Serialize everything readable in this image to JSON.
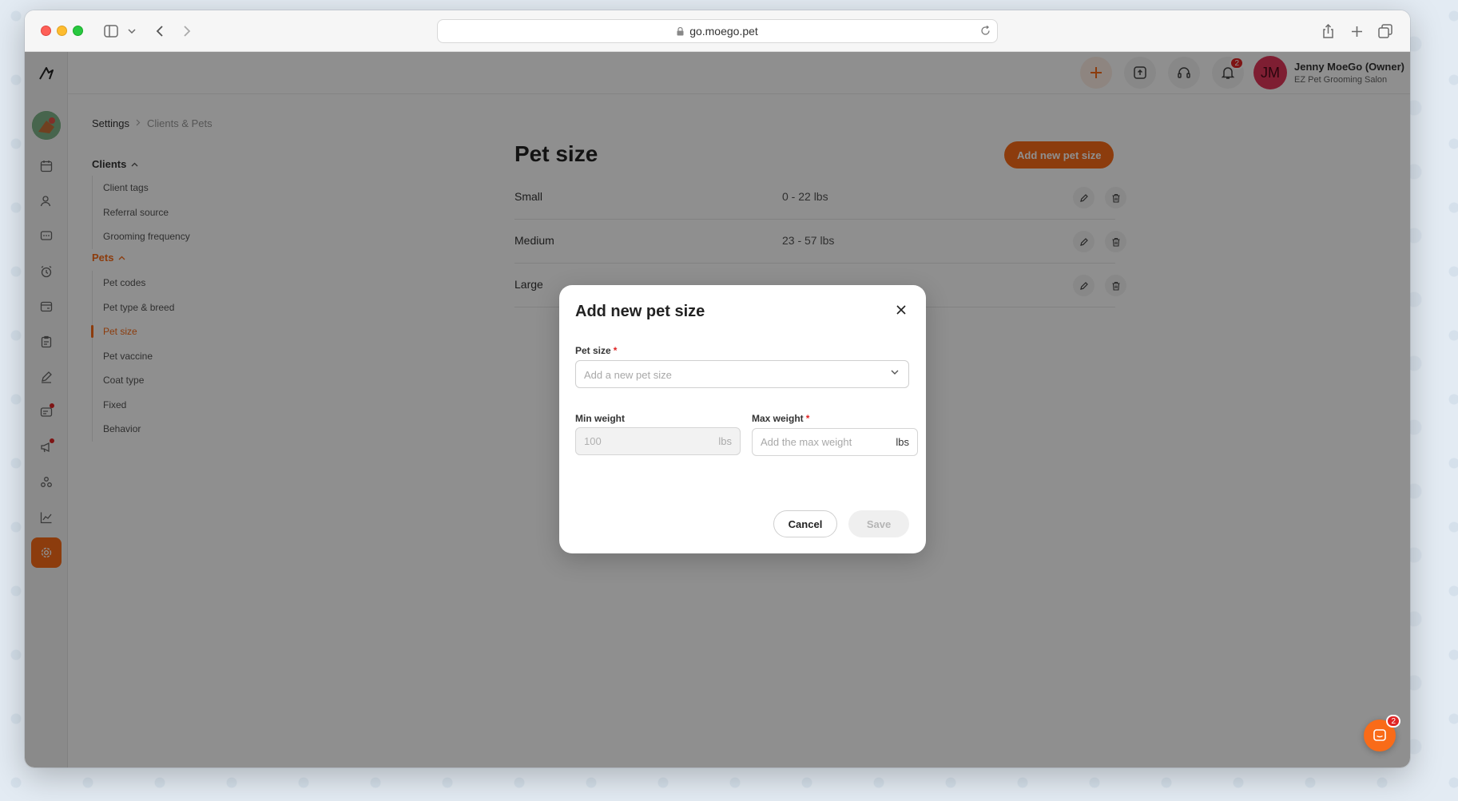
{
  "browser": {
    "url": "go.moego.pet"
  },
  "topbar": {
    "notifications_count": "2",
    "user_initials": "JM",
    "user_name": "Jenny MoeGo (Owner)",
    "business_name": "EZ Pet Grooming Salon"
  },
  "breadcrumb": {
    "root": "Settings",
    "current": "Clients & Pets"
  },
  "sidebar": {
    "clients_group": "Clients",
    "clients_items": [
      "Client tags",
      "Referral source",
      "Grooming frequency"
    ],
    "pets_group": "Pets",
    "pets_items": [
      "Pet codes",
      "Pet type & breed",
      "Pet size",
      "Pet vaccine",
      "Coat type",
      "Fixed",
      "Behavior"
    ],
    "active_item": "Pet size"
  },
  "main": {
    "title": "Pet size",
    "add_button": "Add new pet size",
    "sizes": [
      {
        "name": "Small",
        "range": "0 - 22 lbs"
      },
      {
        "name": "Medium",
        "range": "23 - 57 lbs"
      },
      {
        "name": "Large",
        "range": ""
      }
    ]
  },
  "modal": {
    "title": "Add new pet size",
    "pet_size_label": "Pet size",
    "pet_size_placeholder": "Add a new pet size",
    "min_weight_label": "Min weight",
    "min_weight_value": "100",
    "min_weight_unit": "lbs",
    "max_weight_label": "Max weight",
    "max_weight_placeholder": "Add the max weight",
    "max_weight_unit": "lbs",
    "required_mark": "*",
    "cancel_label": "Cancel",
    "save_label": "Save"
  },
  "chat": {
    "badge_count": "2"
  },
  "colors": {
    "accent": "#f96b18",
    "danger": "#e02424",
    "avatar": "#e1365a"
  }
}
